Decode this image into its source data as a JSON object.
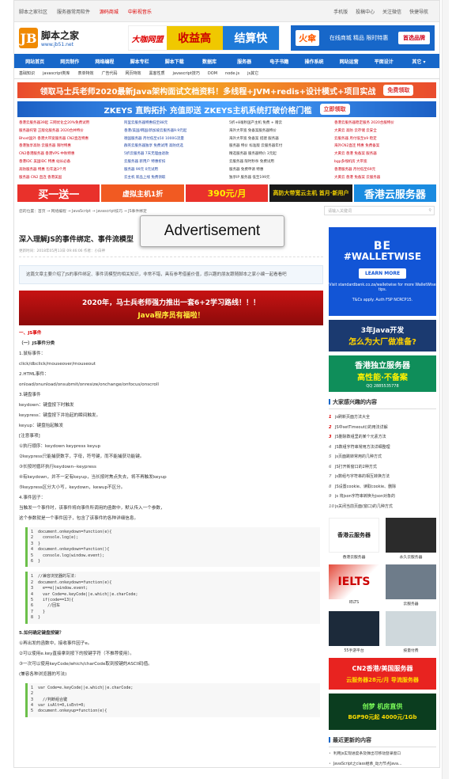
{
  "topbar": {
    "left": [
      "脚本之家社区",
      "服务器常用软件",
      "源码商城",
      "中影视音乐"
    ],
    "right": [
      "手机版",
      "投稿中心",
      "关注微信",
      "快捷导航"
    ]
  },
  "logo": {
    "mark": "JB",
    "name": "脚本之家",
    "url": "www.jb51.net"
  },
  "header_ad1": {
    "a": "大咖网盟",
    "b": "收益高",
    "c": "结算快"
  },
  "header_ad2": {
    "a": "火傘",
    "b": "在线商城 精品 限时特惠",
    "c": "首选品牌"
  },
  "nav": [
    "网站首页",
    "网页制作",
    "网络编程",
    "脚本专栏",
    "脚本下载",
    "数据库",
    "服务器",
    "电子书籍",
    "操作系统",
    "网站运营",
    "平面设计",
    "其它 ▾"
  ],
  "subnav": [
    "基础知识",
    "javascript类库",
    "表单特效",
    "广告代码",
    "网页特效",
    "黑客性质",
    "javascript技巧",
    "DOM",
    "node.js",
    "js其它"
  ],
  "ads": {
    "wide1": "领取马士兵老师2020最新Java架构面试文档资料！多线程+JVM+redis+设计模式+项目实战",
    "wide1_btn": "免费领取",
    "wide2": "ZKEYS 直购拓扑 充值即送 ZKEYS主机系统打破价格门槛",
    "wide2_btn": "立即领取"
  },
  "links": [
    "香港云服务器39起 三网优化全20%免费试用",
    "阿里云服务器特惠低至88元",
    "5折+8毫秒国产主机 免费 + 赠云",
    "香港云服务器稳定服务 2020合服特价",
    "服务器托管 正版化服务器 2020合并特价",
    "香港/美国/韩国/新加坡云服务器9.9元起",
    "海外大带宽 免备案服务器特价",
    "大黄云 高防 云存储 云安全",
    "Bhost国外 香港大带宽服务器 CN2直连特惠",
    "德国服务器 月付低至$50 1000G流量",
    "海外大带宽 免备案 搭建 服务器",
    "云服务器 月付低至$9 稳定",
    "香港独享高防 云服务器 限时特惠",
    "群英云服务器独享 免费试用 高防优选",
    "服务器 特价 标准版 云服务器年付",
    "海外CN2直连 特惠 免费备案",
    "CN2香港服务器 香港VPS 中秋特惠",
    "5折云服务器 7天无理由退款",
    "精选服务器 服务器特价 3元起",
    "大黄云 香港 免备案 服务器",
    "香港IDC 美国IDC 特惠 站长必备",
    "云服务器 新用户 特惠折扣",
    "云服务器 限时秒杀 免费试用",
    "bgp多线机房 大带宽",
    "高防服务器 特惠 包年送3个月",
    "服务器 99元 0元试用",
    "服务器 免费申请 特惠",
    "香港服务器 月付低至69元",
    "服务器 CN2 直连 香港美国",
    "云主机 新品上线 免费领取",
    "独享IP 服务器 低至199元",
    "大黄云 香港 免备案 云服务器"
  ],
  "adrow": [
    "买一送一",
    "虚拟主机1折",
    "390元/月",
    "高防大带宽云主机 首月·新用户",
    "香港云服务器"
  ],
  "crumb": "您的位置：首页 → 网络编程 → JavaScript → javascript技巧 → JS事件绑定",
  "search": {
    "placeholder": "请输入关键词"
  },
  "article": {
    "title": "深入理解JS的事件绑定、事件流模型",
    "meta": "更新时间：2018年05月13日 09:46:06  作者：小白神",
    "summary": "这篇文章主要介绍了JS的事件绑定、事件流模型的相关知识，非常不错，具有参考借鉴价值，感兴趣的朋友跟随脚本之家小编一起看看吧",
    "promo1": "2020年，马士兵老师强力推出一套6+2学习路线！！！",
    "promo2": "Java程序员有福啦！",
    "h1": "一、JS事件",
    "h2": "（一）JS事件分类",
    "p1": "1.鼠标事件：",
    "p2": "click/dbclick/mouseover/mouseout",
    "p3": "2.HTML事件：",
    "p4": "onload/onunload/onsubmit/onresize/onchange/onfocus/onscroll",
    "p5": "3.键盘事件",
    "p6": "keydown：键盘按下时触发",
    "p7": "keypress：键盘按下并抬起的瞬间触发。",
    "p8": "keyup：键盘抬起触发",
    "p9": "[注意事项]",
    "p10": "①执行顺序：keydown keypress keyup",
    "p11": "②keypress只能捕获数字，字母，符号键，而不能捕获功能键。",
    "p12": "③长按时循环执行keydown--keypress",
    "p13": "④有keydown，并不一定有keyup，当长按时焦点失去，将不再触发keyup",
    "p14": "⑤keypress区分大小写，keydown，kewup不区分。",
    "p15": "4.事件因子：",
    "p16": "当触发一个事件时，该事件将向事件所调用的函数中，默认传入一个参数，",
    "p17": "这个参数就是一个事件因子，包含了该事件的各种详细信息。",
    "code1": "1  document.onkeydown=function(e){\n2    console.log(e);\n3  }\n4  document.onkeydown=function(){\n5    console.log(window.event);\n6  }",
    "code2": "1  //兼容浏览器的写法：\n2  document.onkeydown=function(e){\n3    e==e||window.event;\n4    var Code=e.keyCode||e.which||e.charCode;\n5    if(code==13){\n6      //回车\n7    }\n8  }",
    "h3": "5.如何确定键盘按键？",
    "p18": "①再出发的函数中，接收事件因子e。",
    "p19": "②可以使用e.key直接拿到按下的按键字符（不推荐使用）。",
    "p20": "③一次可以使用keyCode/which/charCode取到按键的ASCII码值。",
    "p21": "(兼容各种浏览器的写法)",
    "code3": "1  var Code=e.keyCode||e.which||e.charCode;\n2\n3    //判断组合键\n4  var isAlt=0,isEnt=0;\n5  document.onkeyup=function(e){"
  },
  "side": {
    "wallet": {
      "a": "BE",
      "b": "#WALLETWISE",
      "c": "LEARN MORE",
      "d": "Visit standardbank.co.za/walletwise for more WalletWise tips.",
      "e": "T&Cs apply. Auth FSP NCRCP15."
    },
    "java": {
      "a": "3年Java开发",
      "b": "怎么为大厂做准备?",
      "c": "如果开设掌握这些"
    },
    "hk": {
      "a": "香港独立服务器",
      "b": "高性能·不备案",
      "c": "QQ 2885535778"
    },
    "hot_title": "大家感兴趣的内容",
    "hot": [
      "js刷新页面方法大全",
      "JS中setTimeout()的用法详解",
      "JS删除数组里的某个元素方法",
      "JS数组字符串常用方法详细整理",
      "js页面跳转常用的几种方式",
      "JS打开新窗口的2种方式",
      "js数组与字符串的相互转换方法",
      "JS设置cookie、读取cookie、删除",
      "js 将json字符串转换为json对象的",
      "js关闭当前页面(窗口)的几种方式"
    ],
    "thumbs": [
      "香港云服务器",
      "永久云服务器",
      "IELTS",
      "云服务器",
      "55手游平台",
      "按量付费"
    ],
    "ad_cn2": {
      "a": "CN2香港/美国服务器",
      "b": "云服务器28元/月 导流服务器"
    },
    "ad_cm": {
      "a": "创梦 机房直供",
      "b": "BGP90元起 4000元/1Gb"
    },
    "new_title": "最近更新的内容",
    "new": [
      "利用js实现进度条及弹出可移动登录窗口",
      "JavaScript之class继承_动力节点Java...",
      "js代码判断浏览器种类IE、FF、Opera...",
      "菜单制作学习一个小东西"
    ]
  },
  "advertisement_label": "Advertisement"
}
